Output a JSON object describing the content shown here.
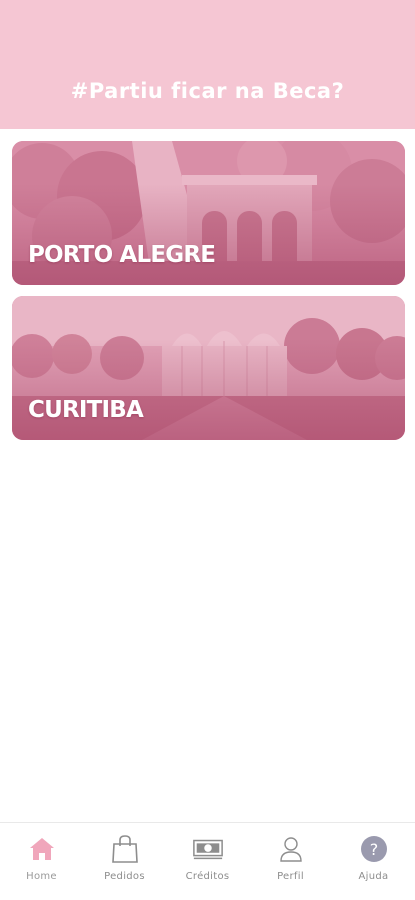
{
  "header": {
    "title": "#Partiu ficar na Beca?"
  },
  "cities": [
    {
      "label": "PORTO ALEGRE"
    },
    {
      "label": "CURITIBA"
    }
  ],
  "bottom_nav": {
    "items": [
      {
        "label": "Home",
        "icon": "home-icon",
        "active": true
      },
      {
        "label": "Pedidos",
        "icon": "shopping-bag-icon",
        "active": false
      },
      {
        "label": "Créditos",
        "icon": "money-icon",
        "active": false
      },
      {
        "label": "Perfil",
        "icon": "user-icon",
        "active": false
      },
      {
        "label": "Ajuda",
        "icon": "help-icon",
        "active": false
      }
    ]
  },
  "colors": {
    "header_bg": "#f5c6d3",
    "accent": "#f0a6bb",
    "card_tint": "#d98ea7",
    "nav_text": "#8d8d8d",
    "help_icon_bg": "#9a9aae"
  }
}
